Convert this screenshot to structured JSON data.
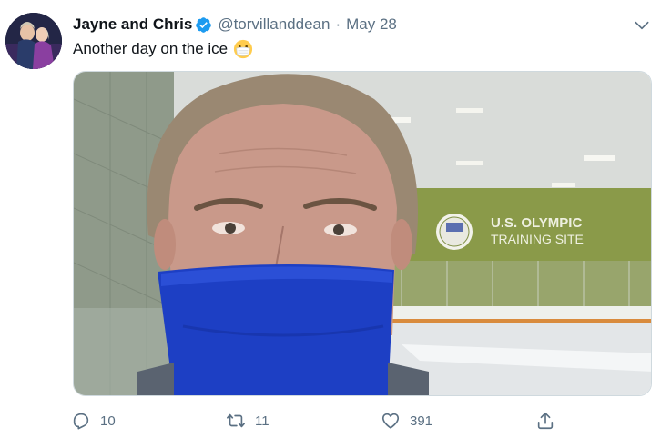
{
  "tweet": {
    "author_name": "Jayne and Chris",
    "handle": "@torvillanddean",
    "separator": "·",
    "date": "May 28",
    "text": "Another day on the ice",
    "media": {
      "sign_line1": "U.S. OLYMPIC",
      "sign_line2": "TRAINING SITE"
    },
    "actions": {
      "reply_count": "10",
      "retweet_count": "11",
      "like_count": "391"
    }
  },
  "icons": [
    "verified-icon",
    "chevron-down-icon",
    "mask-emoji-icon",
    "reply-icon",
    "retweet-icon",
    "like-icon",
    "share-icon"
  ],
  "colors": {
    "verified": "#1d9bf0",
    "muted": "#5b7083",
    "mask": "#1d3fc4",
    "wall": "#8a9a49"
  }
}
